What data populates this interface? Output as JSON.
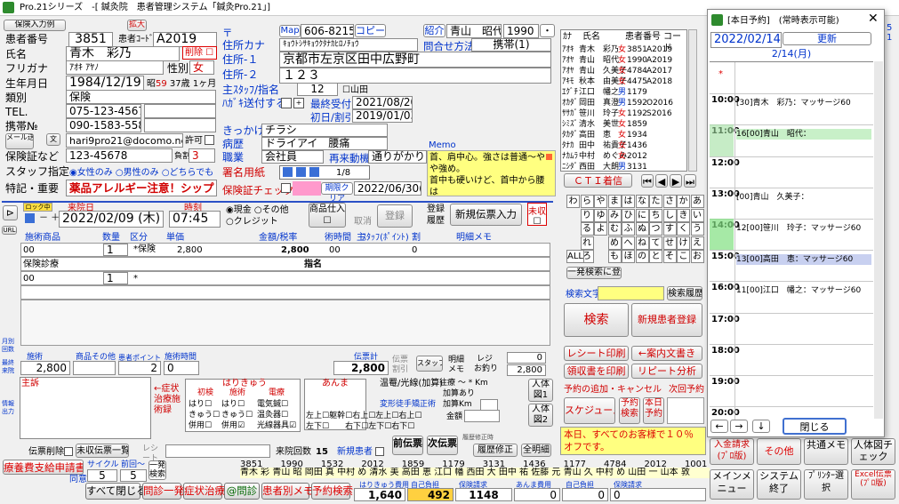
{
  "window": {
    "title": "Pro.21シリーズ　-[ 鍼灸院　患者管理システム「鍼灸Pro.21」]"
  },
  "patient": {
    "btn_input_sample": "保険入力例",
    "btn_zoom": "拡大",
    "label_patient_no": "患者番号",
    "patient_no": "3851",
    "label_patient_code": "患者ｺｰﾄﾞ",
    "patient_code": "A2019",
    "label_name": "氏名",
    "name": "青木　彩乃",
    "delete_label": "削除",
    "label_furigana": "フリガナ",
    "furigana": "ｱｵｷ ｱﾔﾉ",
    "label_sex": "性別",
    "sex": "女",
    "label_birthday": "生年月日",
    "birthday": "1984/12/19",
    "era": "昭",
    "era_year": "59",
    "age": "37",
    "age_unit": "歳",
    "month": "1",
    "month_unit": "ヶ月",
    "label_category": "類別",
    "category": "保険",
    "label_tel": "TEL.",
    "tel": "075-123-4567",
    "label_mobile": "携帯№",
    "mobile": "090-1583-5585",
    "btn_mail": "メール送信",
    "btn_mail2": "文",
    "email": "hari9pro21@docomo.ne.jp",
    "permit": "許可",
    "label_insurance": "保険証など",
    "insurance": "123-45678",
    "burden_label": "負割",
    "burden": "3",
    "label_staff": "スタッフ指定",
    "radio_women": "女性のみ",
    "radio_men": "男性のみ",
    "radio_either": "どちらでも",
    "label_notes": "特記・重要",
    "notes": "薬品アレルギー注意！シップ"
  },
  "address": {
    "postal_mark": "〒",
    "btn_map": "Map",
    "postal": "606-8215",
    "btn_copy": "コピー",
    "btn_intro": "紹介",
    "intro_name": "青山　昭代",
    "intro_no": "1990",
    "btn_dot": "・",
    "label_kana": "住所カナ",
    "kana": "ｷｮｳﾄｼｻｷｮｳｸﾀﾅｶﾋﾛﾉﾁｮｳ",
    "label_inquiry": "問合せ方法",
    "inquiry": "携帯(1)",
    "label_addr1": "住所-１",
    "addr1": "京都市左京区田中広野町",
    "label_addr2": "住所-２",
    "addr2": "１２３",
    "label_staff_nom": "主ｽﾀｯﾌ/指名",
    "staff_no": "12",
    "staff_name": "山田",
    "label_hagaki": "ﾊｶﾞｷ送付する",
    "label_last": "最終受付",
    "last_date": "2021/08/20",
    "label_first": "初日/割引",
    "first_date": "2019/01/03",
    "label_trigger": "きっかけ",
    "trigger": "チラシ",
    "label_disease": "病歴",
    "disease": "ドライアイ　腰痛",
    "label_job": "職業",
    "job": "会社員",
    "label_revisit": "再来動機",
    "revisit": "通りがかり",
    "label_signature": "署名用紙",
    "signature_count": "1/8",
    "label_insurance_check": "保険証チェック",
    "btn_expiry_clear": "期限クリア",
    "insurance_expiry": "2022/06/30(木)",
    "memo_label": "Memo",
    "memo_text": "首、肩中心。強さは普通～やや強め。　\n首中も硬いけど、首中から腰は"
  },
  "patient_list": {
    "headers": [
      "ｶﾅ",
      "氏名",
      "患者番号",
      "コード"
    ],
    "rows": [
      {
        "kana": "ｱｵｷ",
        "name": "青木　彩乃",
        "sex": "女",
        "no": "3851",
        "code": "A2019"
      },
      {
        "kana": "ｱｵﾔ",
        "name": "青山　昭代",
        "sex": "女",
        "no": "1990",
        "code": "A2019"
      },
      {
        "kana": "ｱｵﾔ",
        "name": "青山　久美子",
        "sex": "女",
        "no": "4784",
        "code": "A2017"
      },
      {
        "kana": "ｱｷﾓ",
        "name": "秋本　由美子",
        "sex": "女",
        "no": "4475",
        "code": "A2018"
      },
      {
        "kana": "ｴｸﾞﾁ",
        "name": "江口　幡之",
        "sex": "男",
        "no": "1179",
        "code": ""
      },
      {
        "kana": "ｵｶﾀﾞ",
        "name": "岡田　真澄",
        "sex": "男",
        "no": "1592",
        "code": "O2016"
      },
      {
        "kana": "ｻｻｶﾞ",
        "name": "笹川　玲子",
        "sex": "女",
        "no": "1192",
        "code": "S2016"
      },
      {
        "kana": "ｼﾐｽﾞ",
        "name": "清水　美世",
        "sex": "女",
        "no": "1859",
        "code": ""
      },
      {
        "kana": "ﾀｶﾀﾞ",
        "name": "高田　恵",
        "sex": "女",
        "no": "1934",
        "code": ""
      },
      {
        "kana": "ﾀﾅｶ",
        "name": "田中　祐貴子",
        "sex": "女",
        "no": "1436",
        "code": ""
      },
      {
        "kana": "ﾅｶﾑﾗ",
        "name": "中村　めぐみ",
        "sex": "女",
        "no": "2012",
        "code": ""
      },
      {
        "kana": "ﾆｼﾀﾞ",
        "name": "西田　大朗",
        "sex": "男",
        "no": "3131",
        "code": ""
      }
    ]
  },
  "slip": {
    "btn_lock": "ロック中",
    "label_visit": "来院日",
    "visit_date": "2022/02/09",
    "visit_dow": "(木)",
    "label_time": "時刻",
    "visit_time": "07:45",
    "radio_cash": "現金",
    "radio_other": "その他",
    "radio_credit": "クレジット",
    "btn_items": "商品仕入",
    "btn_cancel": "取消",
    "btn_register": "登録",
    "btn_reg_history": "登録履歴",
    "btn_new_slip": "新規伝票入力",
    "unpaid": "未収",
    "headers": [
      "施術商品",
      "数量",
      "区分",
      "単価",
      "金額/税率",
      "術時間",
      "主",
      "ｽﾀｯﾌ(ﾎﾟｲﾝﾄ)",
      "割",
      "明細メモ"
    ],
    "row1": {
      "code": "00",
      "qty": "1",
      "type": "*保険",
      "price": "2,800",
      "amount": "2,800",
      "time": "00",
      "split": "0"
    },
    "row2": {
      "name": "保険診療"
    },
    "row3": {
      "code": "00",
      "qty": "1",
      "type": "*",
      "shimei": "指名"
    },
    "sum": {
      "label_treatment": "施術",
      "treatment": "2,800",
      "label_goods": "商品その他",
      "label_points": "患者ポイント",
      "points": "2",
      "label_time": "施術時間",
      "time": "0",
      "label_slip_total": "伝票計",
      "slip_total": "2,800",
      "label_discount": "伝票割引",
      "btn_staff": "スタッフ",
      "label_detail_memo": "明細メモ",
      "label_register": "レジ",
      "register_paid": "0",
      "label_change": "お釣り",
      "change": "2,800"
    }
  },
  "treatment": {
    "label_complaint": "主訴",
    "btn_symptom": "←症状治療施術録",
    "label_hari": "はりきゅう",
    "label_first": "初検",
    "label_treat": "施術",
    "label_electro": "電療",
    "c1": "はり",
    "c2": "きゅう",
    "c3": "併用",
    "e1": "電気鍼",
    "e2": "温灸器",
    "e3": "光線器具",
    "label_anma": "あんま",
    "label_warm": "温罨/光線(加算)",
    "label_deform": "変形徒手矯正術",
    "left_up": "左上",
    "body": "躯幹",
    "right_up": "右上",
    "left_down": "左下",
    "right_down": "右下",
    "dist": "往療 ～ * Km",
    "add1": "加算あり",
    "add2": "加算Km",
    "label_amount": "金額",
    "btn_body1": "人体図1",
    "btn_body2": "人体図2",
    "label_slip_delete": "伝票削除",
    "btn_unpaid_list": "未収伝票一覧",
    "label_receipt": "レシート",
    "label_visit_count": "来院回数",
    "visit_count": "15",
    "label_new": "新規患者",
    "btn_prev": "前伝票",
    "btn_next": "次伝票",
    "label_history_note": "履歴修正時",
    "btn_history": "履歴修正",
    "btn_show_all": "全明細"
  },
  "right_panel": {
    "btn_ct": "ＣＴＩ着信",
    "kana_rows": [
      [
        "わ",
        "ら",
        "や",
        "ま",
        "は",
        "な",
        "た",
        "さ",
        "か",
        "あ"
      ],
      [
        "",
        "り",
        "ゆ",
        "み",
        "ひ",
        "に",
        "ち",
        "し",
        "き",
        "い"
      ],
      [
        "",
        "る",
        "よ",
        "む",
        "ふ",
        "ぬ",
        "つ",
        "す",
        "く",
        "う"
      ],
      [
        "",
        "れ",
        "",
        "め",
        "へ",
        "ね",
        "て",
        "せ",
        "け",
        "え"
      ],
      [
        "",
        "ろ",
        "",
        "も",
        "ほ",
        "の",
        "と",
        "そ",
        "こ",
        "お"
      ]
    ],
    "btn_all": "ALL",
    "btn_quick_reg": "一発検索に登録",
    "label_search": "検索文字",
    "btn_search_history": "検索履歴",
    "btn_search": "検索",
    "btn_new_patient": "新規患者登録",
    "btn_receipt_print": "レシート印刷",
    "btn_guide": "案内文書き",
    "btn_receipt_issue": "領収書を印刷",
    "btn_repeat": "リピート分析",
    "label_reservation": "予約の追加・キャンセル",
    "label_next": "次回予約",
    "btn_schedule": "スケジュール",
    "btn_res_search": "予約検索",
    "btn_today_res": "本日予約",
    "notice": "本日、すべてのお客様で１０％オフです。"
  },
  "schedule": {
    "title": "[本日予約]　(常時表示可能)",
    "date": "2022/02/14",
    "btn_update": "更新",
    "day_label": "2/14(月)",
    "times": [
      "10:00",
      "11:00",
      "12:00",
      "13:00",
      "14:00",
      "15:00",
      "16:00",
      "17:00",
      "18:00",
      "19:00",
      "20:00"
    ],
    "entries": [
      {
        "text": "[30]青木　彩乃：マッサージ60"
      },
      {
        "text": "16[00]青山　昭代："
      },
      {
        "text": "[00]青山　久美子："
      },
      {
        "text": "12[00]笹川　玲子：マッサージ60"
      },
      {
        "text": "13[00]高田　恵：マッサージ60"
      },
      {
        "text": "11[00]江口　幡之：マッサージ60"
      }
    ],
    "btn_close": "閉じる"
  },
  "side_buttons": {
    "month_count": "月別回数",
    "month_sales": "最終来院",
    "info_out": "情報出力"
  },
  "bottom": {
    "btn_receipt_req": "療養費支給申請書",
    "label_agree": "同意",
    "label_cycle": "サイクル",
    "cycle": "5",
    "label_prev": "前回～",
    "prev": "5",
    "btn_search_one": "一発検索",
    "ticker1": "3851　　1990　　1532　　2012　　1859　　1179　　3131　　1436　　1177　　4784　　2012　　1001　　3065",
    "ticker2": "青木 彩 青山 昭 岡田 真 中村 め 清水 美 高田 恵 江口 幡 西田 大 田中 祐 佐藤 元 青山 久 中村 め 山田 一 山本 敦",
    "btn_close_all": "すべて閉じる",
    "btn_qa": "問診一発",
    "btn_symptom": "症状治療",
    "btn_ask": "@問診",
    "btn_patient_memo": "患者別メモ",
    "btn_res_search": "予約検索",
    "lbl_hari_fee": "はりきゅう費用",
    "hari_fee": "1,640",
    "lbl_self1": "自己負担",
    "self1": "492",
    "lbl_ins_claim": "保険請求",
    "ins_claim": "1148",
    "lbl_anma": "あんま費用",
    "anma": "0",
    "lbl_self2": "自己負担",
    "self2": "0",
    "lbl_ins2": "保険請求",
    "ins2": "0",
    "btn_deposit": "入金請求(ﾌﾟﾛ版)",
    "btn_other": "その他",
    "btn_common_memo": "共通メモ",
    "btn_body_check": "人体図チェック",
    "btn_main_menu": "メインメニュー",
    "btn_sys_exit": "システム終了",
    "btn_printer": "ﾌﾟﾘﾝﾀｰ選択",
    "btn_excel": "Excel伝票(ﾌﾟﾛ版)"
  }
}
